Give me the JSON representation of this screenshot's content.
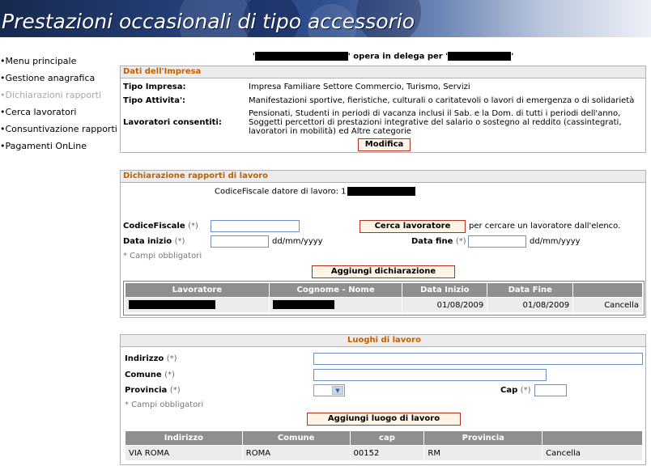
{
  "header": {
    "title": "Prestazioni occasionali di tipo accessorio"
  },
  "nav": {
    "items": [
      {
        "label": "•Menu principale"
      },
      {
        "label": "•Gestione anagrafica"
      },
      {
        "label": "•Dichiarazioni rapporti"
      },
      {
        "label": "•Cerca lavoratori"
      },
      {
        "label": "•Consuntivazione rapporti"
      },
      {
        "label": "•Pagamenti OnLine"
      }
    ]
  },
  "delega": {
    "text1": "'",
    "text2": "' opera in delega per '",
    "text3": "'"
  },
  "impresa": {
    "title": "Dati dell'Impresa",
    "tipo_impresa_label": "Tipo Impresa:",
    "tipo_impresa_value": "Impresa Familiare Settore Commercio, Turismo, Servizi",
    "tipo_attivita_label": "Tipo Attivita':",
    "tipo_attivita_value": "Manifestazioni sportive, fieristiche, culturali o caritatevoli o lavori di emergenza o di solidarietà",
    "lavoratori_label": "Lavoratori consentiti:",
    "lavoratori_line1": "Pensionati, Studenti in periodi di vacanza inclusi il Sab. e la Dom. di tutti i periodi dell'anno,",
    "lavoratori_line2": "Soggetti percettori di prestazioni integrative del salario o sostegno al reddito (cassintegrati,",
    "lavoratori_line3": "lavoratori in mobilità) ed Altre categorie",
    "modifica_button": "Modifica"
  },
  "dichiarazione": {
    "title": "Dichiarazione rapporti di lavoro",
    "codice_datore_label": "CodiceFiscale datore di lavoro: 1",
    "codice_fiscale_label": "CodiceFiscale",
    "req_mark": "(*)",
    "codice_fiscale_value": "",
    "cerca_button": "Cerca lavoratore",
    "cerca_hint": "per cercare un lavoratore dall'elenco.",
    "data_inizio_label": "Data inizio",
    "data_inizio_value": "",
    "data_inizio_format": "dd/mm/yyyy",
    "data_fine_label": "Data fine",
    "data_fine_value": "",
    "data_fine_format": "dd/mm/yyyy",
    "obbligatori_note": "* Campi obbligatori",
    "aggiungi_button": "Aggiungi dichiarazione",
    "table": {
      "headers": [
        "Lavoratore",
        "Cognome - Nome",
        "Data Inizio",
        "Data Fine",
        ""
      ],
      "rows": [
        {
          "data_inizio": "01/08/2009",
          "data_fine": "01/08/2009",
          "action": "Cancella"
        }
      ]
    }
  },
  "luoghi": {
    "title": "Luoghi di lavoro",
    "indirizzo_label": "Indirizzo",
    "indirizzo_value": "",
    "comune_label": "Comune",
    "comune_value": "",
    "provincia_label": "Provincia",
    "provincia_value": "",
    "cap_label": "Cap",
    "cap_value": "",
    "req_mark": "(*)",
    "obbligatori_note": "* Campi obbligatori",
    "aggiungi_button": "Aggiungi luogo di lavoro",
    "table": {
      "headers": [
        "Indirizzo",
        "Comune",
        "cap",
        "Provincia",
        ""
      ],
      "rows": [
        {
          "indirizzo": "VIA ROMA",
          "comune": "ROMA",
          "cap": "00152",
          "provincia": "RM",
          "action": "Cancella"
        }
      ]
    }
  }
}
